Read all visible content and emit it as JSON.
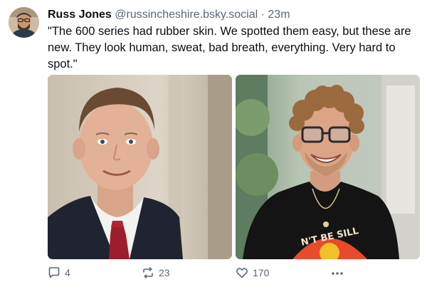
{
  "post": {
    "author": {
      "display_name": "Russ Jones",
      "handle": "@russincheshire.bsky.social",
      "separator": "·",
      "time": "23m"
    },
    "text_lines": [
      "\"The 600 series had rubber skin. We spotted them easy, but these are",
      "new. They look human, sweat, bad breath, everything. Very hard to",
      "spot.\""
    ],
    "images": [
      {
        "icon": "photo-man-suit-red-tie"
      },
      {
        "icon": "photo-man-curly-hair-glasses-black-tshirt",
        "shirt_text": "N'T BE SILL"
      }
    ],
    "actions": {
      "replies": "4",
      "reposts": "23",
      "likes": "170"
    }
  },
  "colors": {
    "text": "#0b0f14",
    "muted": "#5b6877"
  }
}
